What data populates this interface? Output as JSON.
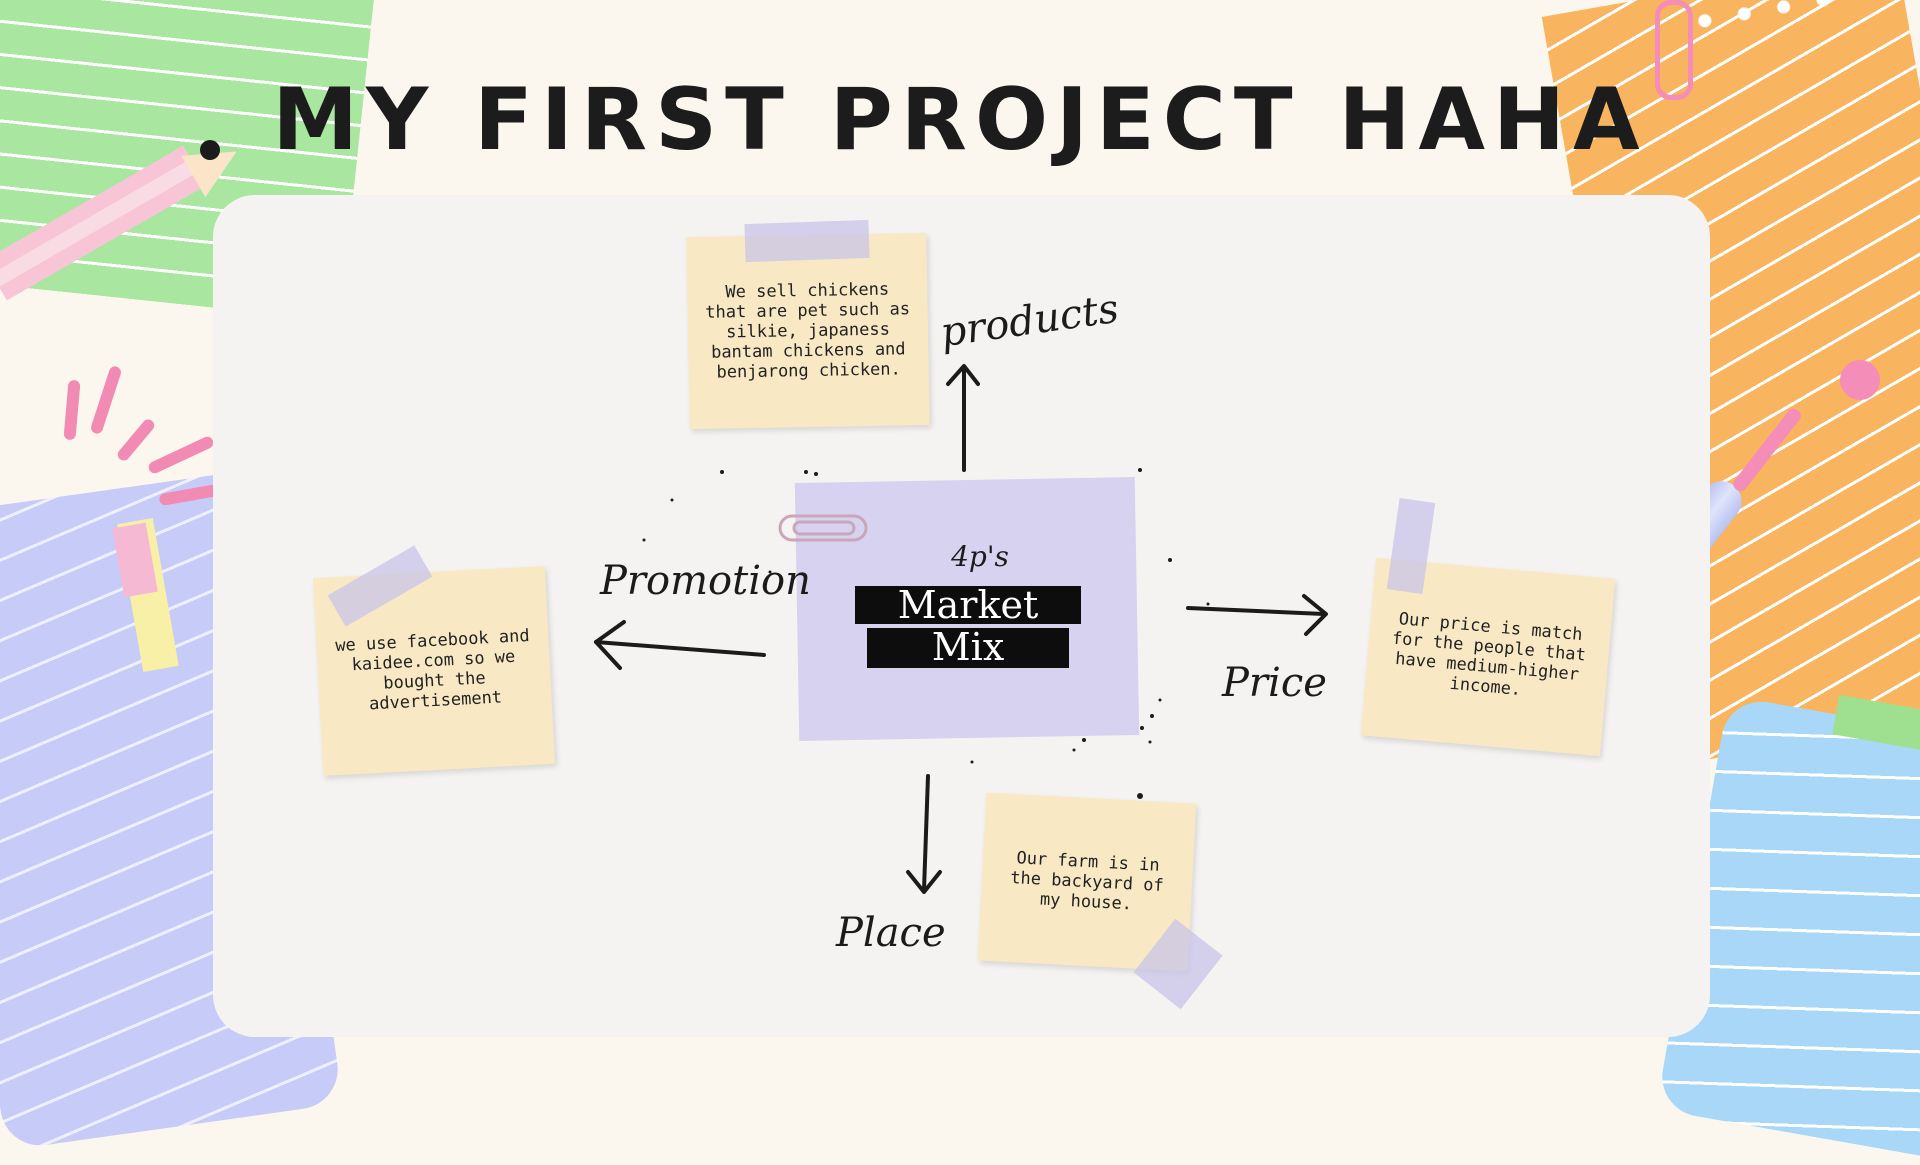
{
  "title": "MY FIRST PROJECT HAHA",
  "center": {
    "small_label": "4p's",
    "line1": "Market",
    "line2": "Mix"
  },
  "branches": {
    "products": {
      "label": "products",
      "note": "We sell chickens that are pet such as silkie, japaness bantam chickens and benjarong chicken."
    },
    "promotion": {
      "label": "Promotion",
      "note": "we use facebook and kaidee.com so we bought the advertisement"
    },
    "price": {
      "label": "Price",
      "note": "Our price is match for the people that have medium-higher income."
    },
    "place": {
      "label": "Place",
      "note": "Our farm is in the backyard of my house."
    }
  },
  "colors": {
    "background": "#fcf7ee",
    "board": "#f5f3f1",
    "sticky_note": "#f8e9c4",
    "center_note": "#d8d2f1",
    "ink": "#1c1c1c"
  }
}
